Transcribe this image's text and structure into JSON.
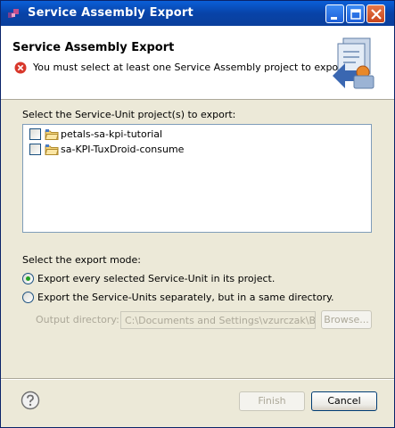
{
  "window": {
    "title": "Service Assembly Export"
  },
  "banner": {
    "title": "Service Assembly Export",
    "message": "You must select at least one Service Assembly project to export."
  },
  "projects": {
    "label": "Select the Service-Unit project(s) to export:",
    "items": [
      {
        "label": "petals-sa-kpi-tutorial",
        "checked": false
      },
      {
        "label": "sa-KPI-TuxDroid-consume",
        "checked": false
      }
    ]
  },
  "export_mode": {
    "label": "Select the export mode:",
    "option_in_project": "Export every selected Service-Unit in its project.",
    "option_separately": "Export the Service-Units separately, but in a same directory.",
    "selected": "in_project"
  },
  "output": {
    "label": "Output directory:",
    "value": "C:\\Documents and Settings\\vzurczak\\Bure",
    "browse_label": "Browse..."
  },
  "footer": {
    "finish_label": "Finish",
    "cancel_label": "Cancel"
  },
  "icons": {
    "title": "app-icon",
    "error": "error-icon",
    "banner": "export-wizard-icon",
    "project": "project-folder-icon",
    "help": "help-icon"
  }
}
